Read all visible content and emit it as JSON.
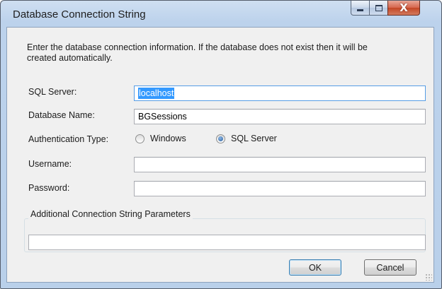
{
  "window": {
    "title": "Database Connection String",
    "controls": {
      "minimize_icon": "minimize-icon",
      "maximize_icon": "maximize-icon",
      "close_icon": "close-icon",
      "close_glyph": "X"
    }
  },
  "intro_text": "Enter the database connection information.  If the database does not exist then it will be created automatically.",
  "form": {
    "sql_server": {
      "label": "SQL Server:",
      "value": "localhost"
    },
    "database_name": {
      "label": "Database Name:",
      "value": "BGSessions"
    },
    "authentication": {
      "label": "Authentication Type:",
      "options": [
        {
          "label": "Windows",
          "checked": false
        },
        {
          "label": "SQL Server",
          "checked": true
        }
      ]
    },
    "username": {
      "label": "Username:",
      "value": ""
    },
    "password": {
      "label": "Password:",
      "value": ""
    }
  },
  "additional": {
    "group_label": "Additional Connection String Parameters",
    "value": ""
  },
  "buttons": {
    "ok": "OK",
    "cancel": "Cancel"
  },
  "colors": {
    "selection": "#3399ff",
    "title_bar": "#bcd2ec",
    "close_button": "#c44625"
  }
}
